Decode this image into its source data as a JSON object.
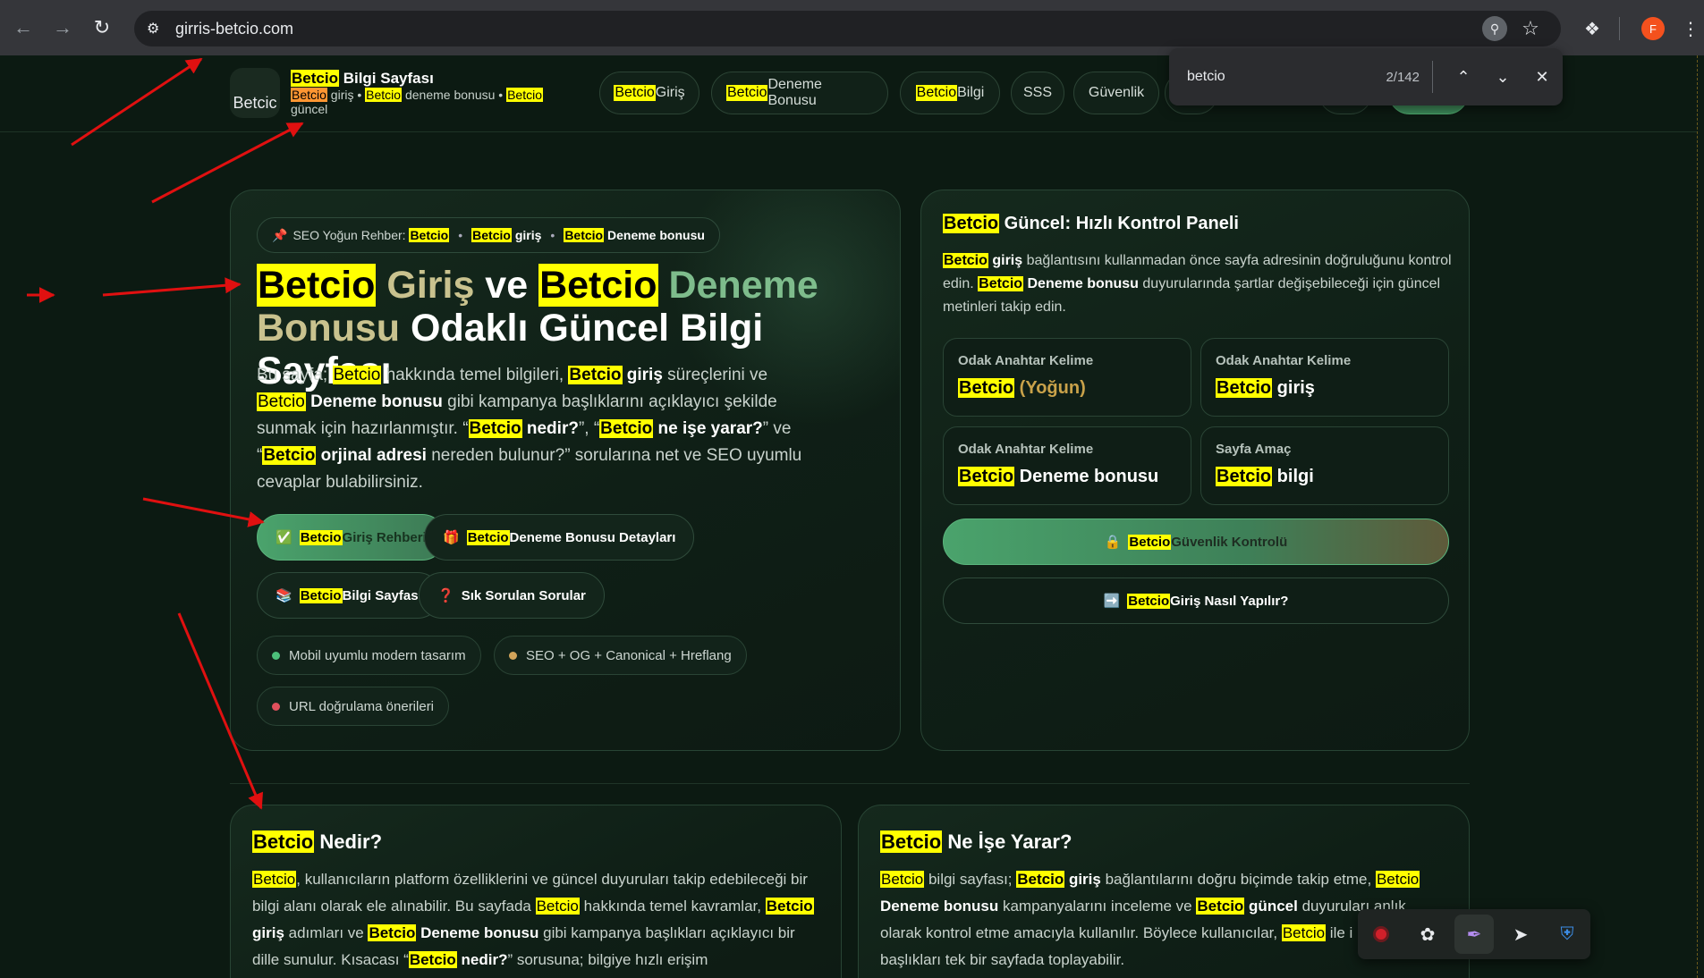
{
  "browser": {
    "url": "girris-betcio.com",
    "avatar_letter": "F",
    "find": {
      "query": "betcio",
      "count": "2/142"
    }
  },
  "header": {
    "logo_alt": "Betcic",
    "title_word": "Betcio",
    "title_rest": " Bilgi Sayfası",
    "sub": {
      "w1": "Betcio",
      "t1": " giriş • ",
      "w2": "Betcio",
      "t2": " deneme bonusu • ",
      "w3": "Betcio",
      "t3": " güncel"
    },
    "nav": [
      {
        "hl": "Betcio",
        "label": " Giriş"
      },
      {
        "hl": "Betcio",
        "label": " Deneme Bonusu"
      },
      {
        "hl": "Betcio",
        "label": " Bilgi"
      },
      {
        "hl": "",
        "label": "SSS"
      },
      {
        "hl": "",
        "label": "Güvenlik"
      }
    ]
  },
  "hero": {
    "chip": {
      "prefix": "SEO Yoğun Rehber:",
      "a": "Betcio",
      "b": "Betcio",
      "b_rest": " giriş",
      "c": "Betcio",
      "c_rest": " Deneme bonusu"
    },
    "h1": {
      "w1": "Betcio",
      "giris": " Giriş",
      "ve": " ve ",
      "w2": "Betcio",
      "deneme": " Deneme",
      "bonusu": "Bonusu",
      "rest": " Odaklı Güncel Bilgi Sayfası"
    },
    "p": {
      "t1": "Bu sayfa; ",
      "w1": "Betcio",
      "t2": " hakkında temel bilgileri, ",
      "w2": "Betcio",
      "b2": " giriş",
      "t3": " süreçlerini ve ",
      "w3": "Betcio",
      "b3": "Deneme bonusu",
      "t4": " gibi kampanya başlıklarını açıklayıcı şekilde sunmak için hazırlanmıştır. “",
      "w4": "Betcio",
      "b4": " nedir?",
      "t5": "”, “",
      "w5": "Betcio",
      "b5": " ne işe yarar?",
      "t6": "” ve “",
      "w6": "Betcio",
      "b6": " orjinal adresi",
      "t7": " nereden bulunur?” sorularına net ve SEO uyumlu cevaplar bulabilirsiniz."
    },
    "buttons": [
      {
        "icon": "✅",
        "hl": "Betcio",
        "label": " Giriş Rehberi"
      },
      {
        "icon": "🎁",
        "hl": "Betcio",
        "label": " Deneme Bonusu Detayları"
      },
      {
        "icon": "📚",
        "hl": "Betcio",
        "label": " Bilgi Sayfası"
      },
      {
        "icon": "❓",
        "hl": "",
        "label": "Sık Sorulan Sorular"
      }
    ],
    "tags": [
      {
        "label": "Mobil uyumlu modern tasarım",
        "color": "#4cc07a"
      },
      {
        "label": "SEO + OG + Canonical + Hreflang",
        "color": "#d2a45a"
      },
      {
        "label": "URL doğrulama önerileri",
        "color": "#e0505c"
      }
    ]
  },
  "panel": {
    "title_hl": "Betcio",
    "title_rest": " Güncel: Hızlı Kontrol Paneli",
    "p": {
      "w1": "Betcio",
      "b1": " giriş",
      "t1": " bağlantısını kullanmadan önce sayfa adresinin doğruluğunu kontrol edin. ",
      "w2": "Betcio",
      "b2": " Deneme bonusu",
      "t2": " duyurularında şartlar değişebileceği için güncel metinleri takip edin."
    },
    "keywords": [
      {
        "label": "Odak Anahtar Kelime",
        "hl": "Betcio",
        "value": "",
        "gold": " (Yoğun)"
      },
      {
        "label": "Odak Anahtar Kelime",
        "hl": "Betcio",
        "value": " giriş",
        "gold": ""
      },
      {
        "label": "Odak Anahtar Kelime",
        "hl": "Betcio",
        "value": " Deneme bonusu",
        "gold": ""
      },
      {
        "label": "Sayfa Amaç",
        "hl": "Betcio",
        "value": " bilgi",
        "gold": ""
      }
    ],
    "security_btn": {
      "icon": "🔒",
      "hl": "Betcio",
      "label": " Güvenlik Kontrolü"
    },
    "how_btn": {
      "icon": "➡️",
      "hl": "Betcio",
      "label": " Giriş Nasıl Yapılır?"
    }
  },
  "cards": [
    {
      "title_hl": "Betcio",
      "title_rest": " Nedir?",
      "p": {
        "w1": "Betcio",
        "t1": ", kullanıcıların platform özelliklerini ve güncel duyuruları takip edebileceği bir bilgi alanı olarak ele alınabilir. Bu sayfada ",
        "w2": "Betcio",
        "t2": " hakkında temel kavramlar, ",
        "w3": "Betcio",
        "b3": " giriş",
        "t3": " adımları ve ",
        "w4": "Betcio",
        "b4": " Deneme bonusu",
        "t4": " gibi kampanya başlıkları açıklayıcı bir dille sunulur. Kısacası “",
        "w5": "Betcio",
        "b5": " nedir?",
        "t5": "” sorusuna; bilgiye hızlı erişim"
      }
    },
    {
      "title_hl": "Betcio",
      "title_rest": " Ne İşe Yarar?",
      "p": {
        "w1": "Betcio",
        "t1": " bilgi sayfası; ",
        "w2": "Betcio",
        "b2": " giriş",
        "t2": " bağlantılarını doğru biçimde takip etme, ",
        "w3": "Betcio",
        "b3": "Deneme bonusu",
        "t3": " kampanyalarını inceleme ve ",
        "w4": "Betcio",
        "b4": " güncel",
        "t4": " duyuruları anlık olarak kontrol etme amacıyla kullanılır. Böylece kullanıcılar, ",
        "w5": "Betcio",
        "t5": " ile i",
        "t6": "başlıkları tek bir sayfada toplayabilir."
      }
    }
  ]
}
